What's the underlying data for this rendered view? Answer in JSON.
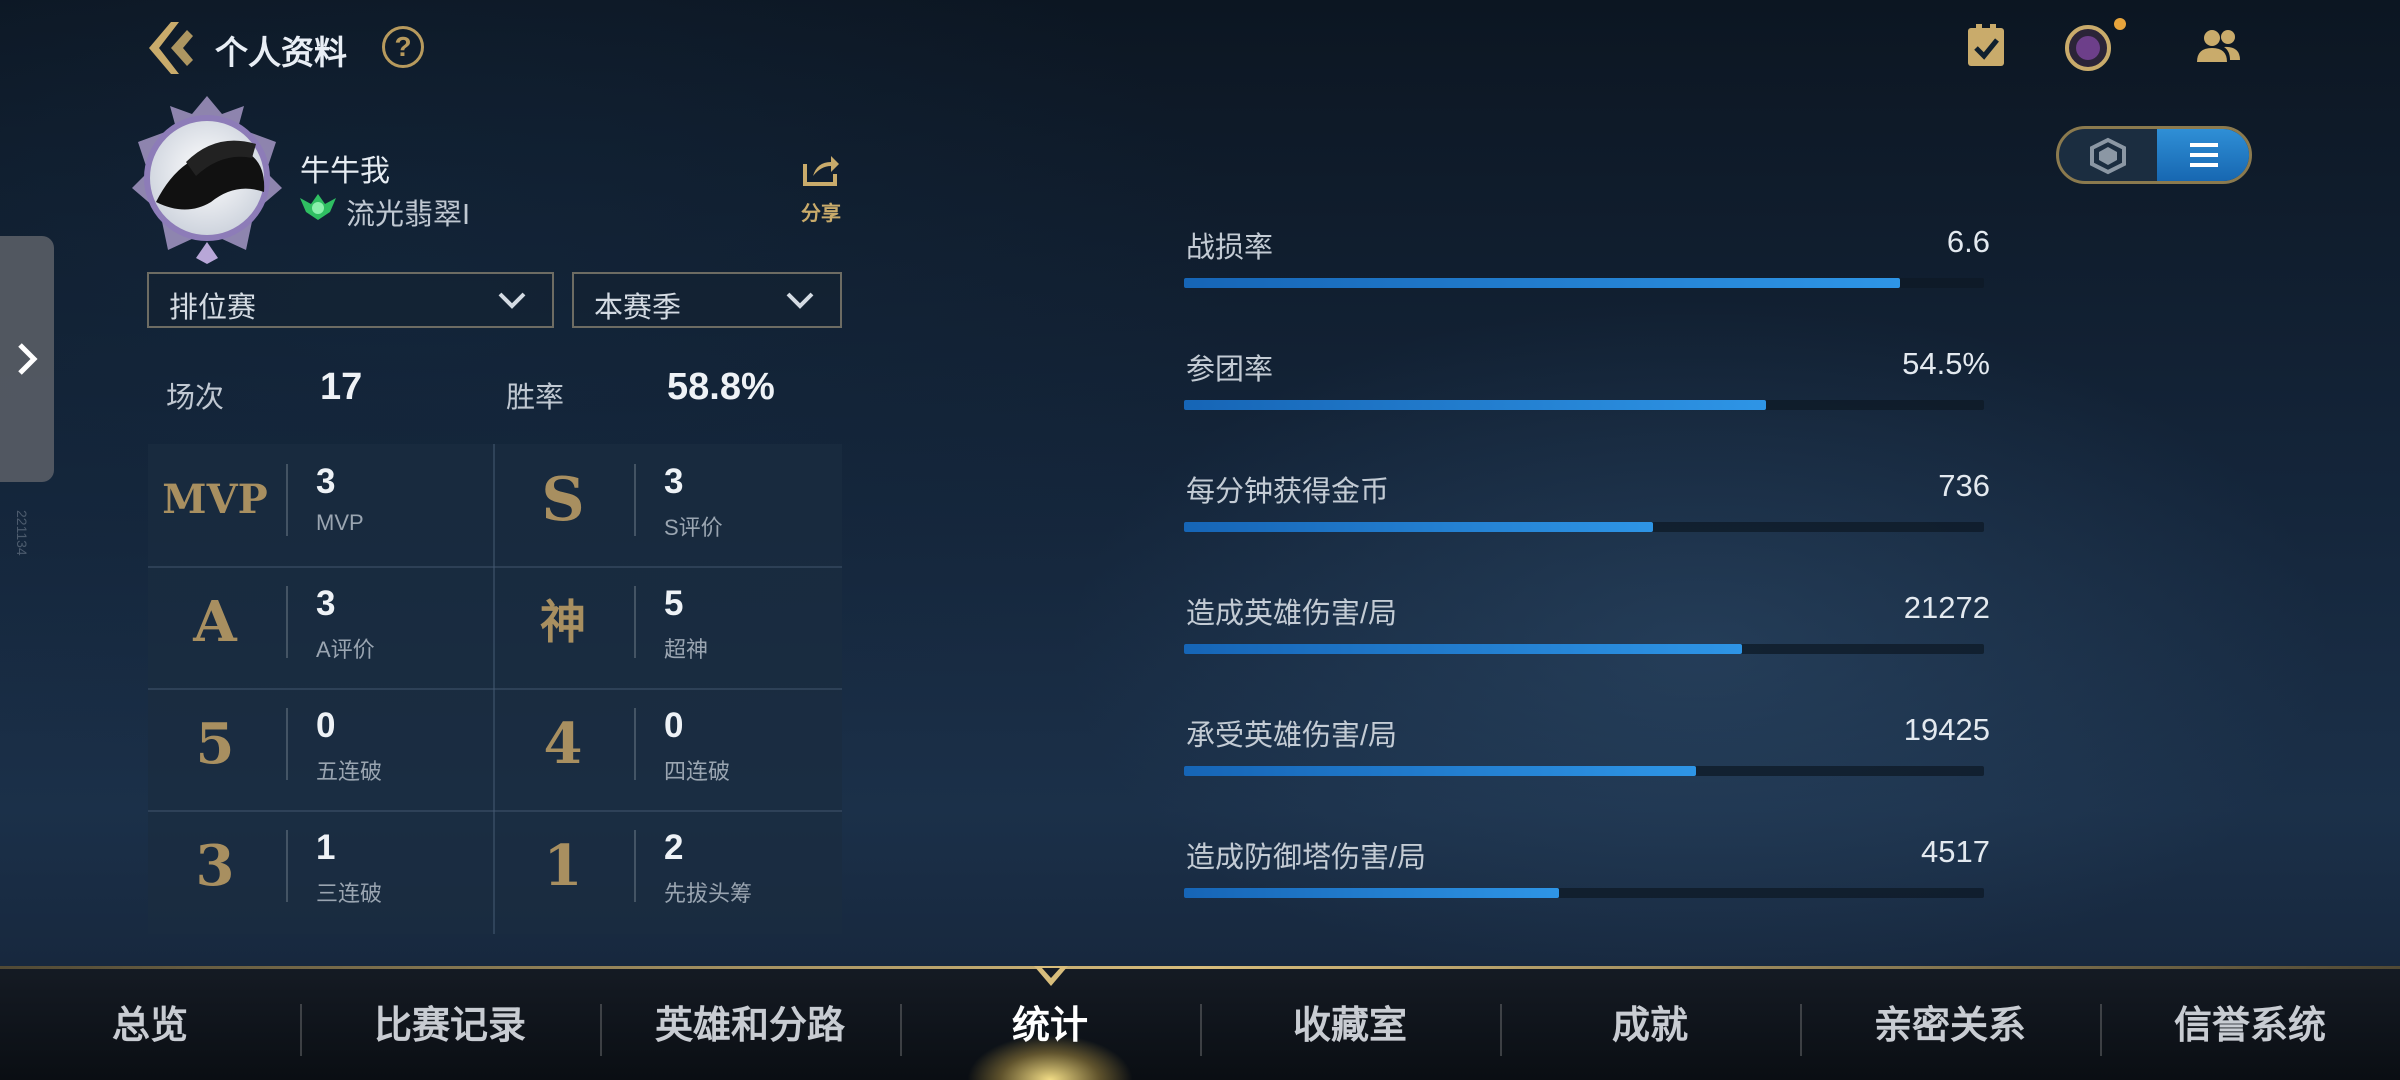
{
  "header": {
    "title": "个人资料",
    "help_symbol": "?"
  },
  "profile": {
    "nickname": "牛牛我",
    "rank_name": "流光翡翠I",
    "share_label": "分享"
  },
  "side_panel": {
    "id_text": "221134"
  },
  "filters": {
    "mode_selected": "排位赛",
    "season_selected": "本赛季"
  },
  "summary": {
    "matches_label": "场次",
    "matches_value": "17",
    "winrate_label": "胜率",
    "winrate_value": "58.8%"
  },
  "stats": [
    {
      "icon": "MVP",
      "value": "3",
      "label": "MVP"
    },
    {
      "icon": "S",
      "value": "3",
      "label": "S评价"
    },
    {
      "icon": "A",
      "value": "3",
      "label": "A评价"
    },
    {
      "icon": "神",
      "value": "5",
      "label": "超神"
    },
    {
      "icon": "5",
      "value": "0",
      "label": "五连破"
    },
    {
      "icon": "4",
      "value": "0",
      "label": "四连破"
    },
    {
      "icon": "3",
      "value": "1",
      "label": "三连破"
    },
    {
      "icon": "1",
      "value": "2",
      "label": "先拔头筹"
    }
  ],
  "metrics": [
    {
      "label": "战损率",
      "value": "6.6",
      "fill": 0.895
    },
    {
      "label": "参团率",
      "value": "54.5%",
      "fill": 0.728
    },
    {
      "label": "每分钟获得金币",
      "value": "736",
      "fill": 0.586
    },
    {
      "label": "造成英雄伤害/局",
      "value": "21272",
      "fill": 0.698
    },
    {
      "label": "承受英雄伤害/局",
      "value": "19425",
      "fill": 0.64
    },
    {
      "label": "造成防御塔伤害/局",
      "value": "4517",
      "fill": 0.469
    }
  ],
  "nav": {
    "items": [
      "总览",
      "比赛记录",
      "英雄和分路",
      "统计",
      "收藏室",
      "成就",
      "亲密关系",
      "信誉系统"
    ],
    "active_index": 3
  },
  "colors": {
    "accent_gold": "#c9ab6b",
    "bar_blue": "#2e95e6",
    "toggle_active": "#1f7cc8"
  }
}
